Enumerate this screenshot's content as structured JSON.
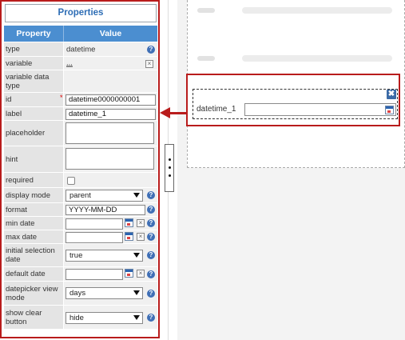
{
  "panel": {
    "title": "Properties",
    "col_property": "Property",
    "col_value": "Value"
  },
  "rows": {
    "type": {
      "label": "type",
      "value": "datetime"
    },
    "variable": {
      "label": "variable",
      "value": "..."
    },
    "variable_data_type": {
      "label": "variable data type"
    },
    "id": {
      "label": "id",
      "value": "datetime0000000001"
    },
    "label": {
      "label": "label",
      "value": "datetime_1"
    },
    "placeholder": {
      "label": "placeholder"
    },
    "hint": {
      "label": "hint"
    },
    "required": {
      "label": "required",
      "checked": false
    },
    "display_mode": {
      "label": "display mode",
      "value": "parent"
    },
    "format": {
      "label": "format",
      "value": "YYYY-MM-DD"
    },
    "min_date": {
      "label": "min date",
      "value": ""
    },
    "max_date": {
      "label": "max date",
      "value": ""
    },
    "initial_selection_date": {
      "label": "initial selection date",
      "value": "true"
    },
    "default_date": {
      "label": "default date",
      "value": ""
    },
    "datepicker_view_mode": {
      "label": "datepicker view mode",
      "value": "days"
    },
    "show_clear_button": {
      "label": "show clear button",
      "value": "hide"
    }
  },
  "canvas": {
    "field_label": "datetime_1",
    "remove_glyph": "✖"
  },
  "colors": {
    "highlight": "#b91c1c",
    "header": "#4b8ed0",
    "title_text": "#2d6db5"
  }
}
